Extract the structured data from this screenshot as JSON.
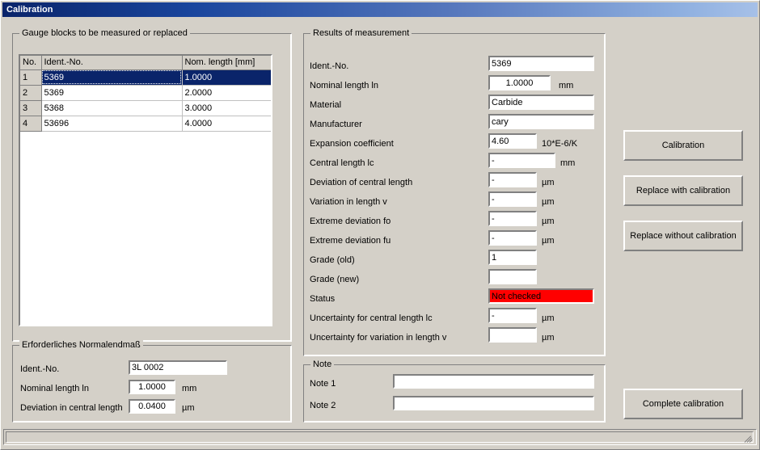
{
  "window": {
    "title": "Calibration"
  },
  "gauge_group": {
    "title": "Gauge blocks to be measured or replaced",
    "columns": [
      "No.",
      "Ident.-No.",
      "Nom. length [mm]"
    ],
    "rows": [
      {
        "no": "1",
        "ident": "5369",
        "nominal": "1.0000",
        "selected": true
      },
      {
        "no": "2",
        "ident": "5369",
        "nominal": "2.0000",
        "selected": false
      },
      {
        "no": "3",
        "ident": "5368",
        "nominal": "3.0000",
        "selected": false
      },
      {
        "no": "4",
        "ident": "53696",
        "nominal": "4.0000",
        "selected": false
      }
    ]
  },
  "standard_group": {
    "title": "Erforderliches Normalendmaß",
    "ident_label": "Ident.-No.",
    "ident_value": "3L 0002",
    "nominal_label": "Nominal length ln",
    "nominal_value": "1.0000",
    "nominal_unit": "mm",
    "deviation_label": "Deviation in central length",
    "deviation_value": "0.0400",
    "deviation_unit": "µm"
  },
  "results_group": {
    "title": "Results of measurement",
    "fields": [
      {
        "label": "Ident.-No.",
        "value": "5369",
        "unit": ""
      },
      {
        "label": "Nominal length ln",
        "value": "1.0000",
        "unit": "mm"
      },
      {
        "label": "Material",
        "value": "Carbide",
        "unit": ""
      },
      {
        "label": "Manufacturer",
        "value": "cary",
        "unit": ""
      },
      {
        "label": "Expansion coefficient",
        "value": "4.60",
        "unit": "10*E-6/K"
      },
      {
        "label": "Central length lc",
        "value": "-",
        "unit": "mm"
      },
      {
        "label": "Deviation of central length",
        "value": "-",
        "unit": "µm"
      },
      {
        "label": "Variation in length v",
        "value": "-",
        "unit": "µm"
      },
      {
        "label": "Extreme deviation fo",
        "value": "-",
        "unit": "µm"
      },
      {
        "label": "Extreme deviation fu",
        "value": "-",
        "unit": "µm"
      },
      {
        "label": "Grade (old)",
        "value": "1",
        "unit": ""
      },
      {
        "label": "Grade (new)",
        "value": "",
        "unit": ""
      },
      {
        "label": "Status",
        "value": "Not checked",
        "unit": ""
      },
      {
        "label": "Uncertainty for central length lc",
        "value": "-",
        "unit": "µm"
      },
      {
        "label": "Uncertainty for variation in length v",
        "value": "",
        "unit": "µm"
      }
    ]
  },
  "note_group": {
    "title": "Note",
    "note1_label": "Note 1",
    "note1_value": "",
    "note2_label": "Note 2",
    "note2_value": ""
  },
  "buttons": {
    "calibration": "Calibration",
    "replace_with": "Replace with calibration",
    "replace_without": "Replace without calibration",
    "complete": "Complete calibration"
  },
  "colors": {
    "face": "#d4d0c8",
    "title_start": "#0a246a",
    "title_end": "#a6c0e8",
    "selection": "#0a246a",
    "status_alert": "#ff0000"
  },
  "statusbar": {
    "text": ""
  }
}
